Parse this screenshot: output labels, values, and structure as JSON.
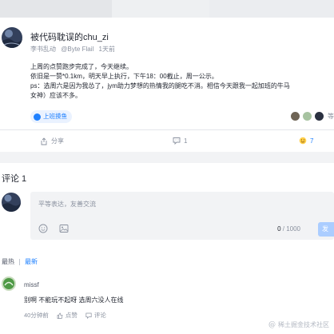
{
  "post": {
    "username": "被代码耽误的chu_zi",
    "title_role": "李书乱动",
    "company": "@Byte Flail",
    "time": "1天前",
    "content": [
      "上周的点赞跑步完成了，今天继续。",
      "依旧是一赞*0.1km，明天早上执行，下午18：00截止，周一公示。",
      "ps：选周六是因为我怂了，jym助力梦想的热情我的腿吃不消。相信今天跟我一起加班的牛马",
      "女神）应该不多。"
    ],
    "tag": "上班摸鱼",
    "reactors_more": "等",
    "actions": {
      "share": "分享",
      "comment_count": "1",
      "like_count": "7"
    }
  },
  "comments": {
    "title": "评论 1",
    "editor": {
      "placeholder": "平等表达，友善交流",
      "count": "0",
      "max": "/ 1000",
      "send": "发"
    },
    "sort": {
      "hot": "最热",
      "new": "最新"
    },
    "items": [
      {
        "user": "missf",
        "text": "别啊 不能玩不起呀 选周六没人在线",
        "time": "40分钟前",
        "like_label": "点赞",
        "reply_label": "评论"
      }
    ]
  },
  "watermark": "稀土掘金技术社区",
  "icons": [
    "share-icon",
    "comment-icon",
    "like-icon",
    "emoji-icon",
    "image-icon",
    "thumb-icon",
    "reply-icon",
    "juejin-logo-icon"
  ],
  "colors": {
    "accent": "#1e80ff",
    "muted": "#8a919f",
    "band": "#f2f3f5"
  }
}
